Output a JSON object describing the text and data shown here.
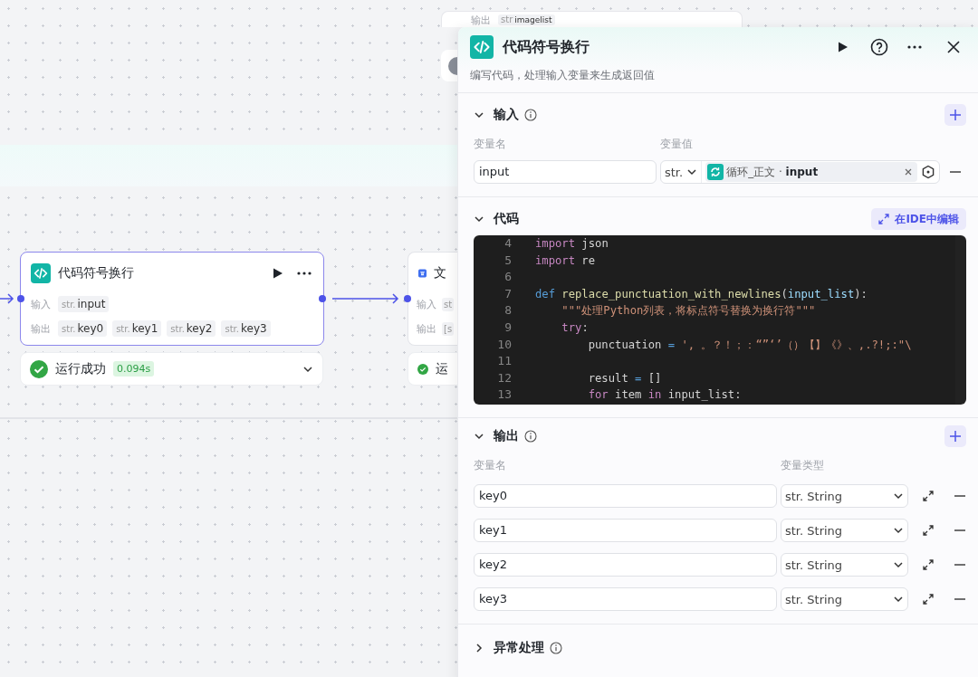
{
  "canvas": {
    "nodes": [
      {
        "kind": "partial_top",
        "outputs_label": "输出",
        "outputs": [
          {
            "type": "str",
            "name": "imagelist"
          }
        ]
      },
      {
        "kind": "stub"
      },
      {
        "kind": "code_node",
        "title": "代码符号换行",
        "selected": true,
        "inputs_label": "输入",
        "inputs": [
          {
            "type": "str.",
            "name": "input"
          }
        ],
        "outputs_label": "输出",
        "outputs": [
          {
            "type": "str.",
            "name": "key0"
          },
          {
            "type": "str.",
            "name": "key1"
          },
          {
            "type": "str.",
            "name": "key2"
          },
          {
            "type": "str.",
            "name": "key3"
          }
        ],
        "status": {
          "ok": true,
          "text": "运行成功",
          "time": "0.094s"
        }
      },
      {
        "kind": "text_node",
        "title": "文",
        "selected": false,
        "inputs_label": "输入",
        "inputs": [
          {
            "type": "st"
          }
        ],
        "outputs_label": "输出",
        "outputs": [
          {
            "type": "[s"
          }
        ],
        "status": {
          "ok": true,
          "text": "运"
        }
      }
    ]
  },
  "panel": {
    "title": "代码符号换行",
    "description": "编写代码，处理输入变量来生成返回值",
    "input": {
      "title": "输入",
      "expanded": true,
      "col_name": "变量名",
      "col_value": "变量值",
      "rows": [
        {
          "name": "input",
          "type": "str.",
          "ref": "循环_正文 · **input**"
        }
      ]
    },
    "code": {
      "title": "代码",
      "expanded": true,
      "ide_button": "在IDE中编辑",
      "lines": [
        {
          "number": "4",
          "tokens": [
            {
              "kind": "kw",
              "text": "import"
            },
            {
              "kind": "plain",
              "text": " json"
            }
          ]
        },
        {
          "number": "5",
          "tokens": [
            {
              "kind": "kw",
              "text": "import"
            },
            {
              "kind": "plain",
              "text": " re"
            }
          ]
        },
        {
          "number": "6"
        },
        {
          "number": "7",
          "tokens": [
            {
              "kind": "def",
              "text": "def "
            },
            {
              "kind": "fn",
              "text": "replace_punctuation_with_newlines"
            },
            {
              "kind": "plain",
              "text": "("
            },
            {
              "kind": "param",
              "text": "input_list"
            },
            {
              "kind": "plain",
              "text": "):"
            }
          ]
        },
        {
          "number": "8",
          "tokens": [
            {
              "kind": "str",
              "text": "    \"\"\"处理Python列表，将标点符号替换为换行符\"\"\""
            }
          ]
        },
        {
          "number": "9",
          "tokens": [
            {
              "kind": "kw",
              "text": "    try"
            },
            {
              "kind": "plain",
              "text": ":"
            }
          ]
        },
        {
          "number": "10",
          "tokens": [
            {
              "kind": "plain",
              "text": "        punctuation "
            },
            {
              "kind": "op",
              "text": "= "
            },
            {
              "kind": "str",
              "text": "', 。？！；：“”‘’（）【】《》、,.?!;:\"\\"
            }
          ]
        },
        {
          "number": "11"
        },
        {
          "number": "12",
          "tokens": [
            {
              "kind": "plain",
              "text": "        result "
            },
            {
              "kind": "op",
              "text": "="
            },
            {
              "kind": "plain",
              "text": " []"
            }
          ]
        },
        {
          "number": "13",
          "tokens": [
            {
              "kind": "kw",
              "text": "        for"
            },
            {
              "kind": "plain",
              "text": " item "
            },
            {
              "kind": "kw",
              "text": "in"
            },
            {
              "kind": "plain",
              "text": " input_list:"
            }
          ]
        }
      ]
    },
    "output": {
      "title": "输出",
      "expanded": true,
      "col_name": "变量名",
      "col_type": "变量类型",
      "rows": [
        {
          "name": "key0",
          "type": "str. String"
        },
        {
          "name": "key1",
          "type": "str. String"
        },
        {
          "name": "key2",
          "type": "str. String"
        },
        {
          "name": "key3",
          "type": "str. String"
        }
      ]
    },
    "error": {
      "title": "异常处理",
      "expanded": false
    }
  }
}
